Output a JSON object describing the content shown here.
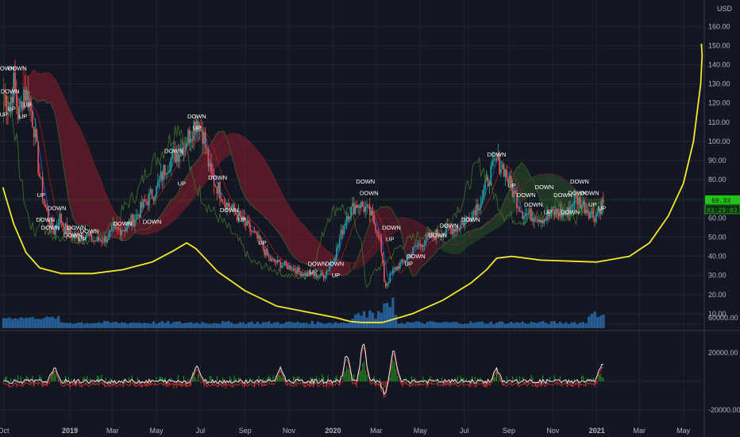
{
  "chart_data": {
    "type": "line",
    "title": "",
    "currency_label": "USD",
    "price_axis": {
      "ticks": [
        "160.00",
        "150.00",
        "140.00",
        "130.00",
        "120.00",
        "110.00",
        "100.00",
        "90.00",
        "80.00",
        "70.00",
        "60.00",
        "50.00",
        "40.00",
        "30.00",
        "20.00",
        "10.00"
      ],
      "ylim": [
        5,
        168
      ]
    },
    "time_axis": {
      "ticks": [
        "Oct",
        "2019",
        "Mar",
        "May",
        "Jul",
        "Sep",
        "Nov",
        "2020",
        "Mar",
        "May",
        "Jul",
        "Sep",
        "Nov",
        "2021",
        "Mar",
        "May"
      ],
      "xlim": [
        "2018-09-26",
        "2021-05-30"
      ]
    },
    "oscillator_axis": {
      "ticks": [
        "60000.00",
        "20000.00",
        "-20000.00"
      ]
    },
    "last_price_tag": "69.33",
    "countdown_tag": "03:29:03",
    "colors": {
      "background": "#131722",
      "up": "#26a69a",
      "down": "#ef5350",
      "cloud_bear": "#8b1e2e",
      "cloud_bull": "#2e5d2e",
      "annotation": "#f5e82a",
      "volume": "#2a6aa8",
      "price_tag": "#22c41a",
      "osc_line": "#e6e6e6"
    },
    "price_series": [
      {
        "x": "2018-10-01",
        "y": 125
      },
      {
        "x": "2018-10-08",
        "y": 118
      },
      {
        "x": "2018-10-15",
        "y": 130
      },
      {
        "x": "2018-10-22",
        "y": 112
      },
      {
        "x": "2018-10-29",
        "y": 127
      },
      {
        "x": "2018-11-05",
        "y": 122
      },
      {
        "x": "2018-11-12",
        "y": 108
      },
      {
        "x": "2018-11-19",
        "y": 84
      },
      {
        "x": "2018-11-26",
        "y": 68
      },
      {
        "x": "2018-12-03",
        "y": 58
      },
      {
        "x": "2018-12-10",
        "y": 53
      },
      {
        "x": "2018-12-17",
        "y": 61
      },
      {
        "x": "2018-12-24",
        "y": 55
      },
      {
        "x": "2019-01-07",
        "y": 50
      },
      {
        "x": "2019-01-21",
        "y": 52
      },
      {
        "x": "2019-02-04",
        "y": 48
      },
      {
        "x": "2019-02-18",
        "y": 49
      },
      {
        "x": "2019-03-04",
        "y": 53
      },
      {
        "x": "2019-03-18",
        "y": 55
      },
      {
        "x": "2019-04-01",
        "y": 60
      },
      {
        "x": "2019-04-15",
        "y": 68
      },
      {
        "x": "2019-05-01",
        "y": 75
      },
      {
        "x": "2019-05-15",
        "y": 88
      },
      {
        "x": "2019-06-01",
        "y": 95
      },
      {
        "x": "2019-06-15",
        "y": 103
      },
      {
        "x": "2019-06-26",
        "y": 112
      },
      {
        "x": "2019-07-05",
        "y": 104
      },
      {
        "x": "2019-07-15",
        "y": 82
      },
      {
        "x": "2019-07-25",
        "y": 76
      },
      {
        "x": "2019-08-05",
        "y": 68
      },
      {
        "x": "2019-08-20",
        "y": 62
      },
      {
        "x": "2019-09-05",
        "y": 55
      },
      {
        "x": "2019-09-20",
        "y": 48
      },
      {
        "x": "2019-10-05",
        "y": 38
      },
      {
        "x": "2019-10-20",
        "y": 36
      },
      {
        "x": "2019-11-05",
        "y": 34
      },
      {
        "x": "2019-11-20",
        "y": 31
      },
      {
        "x": "2019-12-05",
        "y": 30
      },
      {
        "x": "2019-12-20",
        "y": 30
      },
      {
        "x": "2020-01-05",
        "y": 42
      },
      {
        "x": "2020-01-20",
        "y": 62
      },
      {
        "x": "2020-02-05",
        "y": 68
      },
      {
        "x": "2020-02-20",
        "y": 63
      },
      {
        "x": "2020-03-05",
        "y": 52
      },
      {
        "x": "2020-03-13",
        "y": 24
      },
      {
        "x": "2020-03-25",
        "y": 33
      },
      {
        "x": "2020-04-10",
        "y": 38
      },
      {
        "x": "2020-04-25",
        "y": 45
      },
      {
        "x": "2020-05-10",
        "y": 49
      },
      {
        "x": "2020-05-25",
        "y": 52
      },
      {
        "x": "2020-06-10",
        "y": 54
      },
      {
        "x": "2020-06-25",
        "y": 56
      },
      {
        "x": "2020-07-10",
        "y": 62
      },
      {
        "x": "2020-07-25",
        "y": 70
      },
      {
        "x": "2020-08-05",
        "y": 82
      },
      {
        "x": "2020-08-15",
        "y": 90
      },
      {
        "x": "2020-08-25",
        "y": 86
      },
      {
        "x": "2020-09-05",
        "y": 75
      },
      {
        "x": "2020-09-20",
        "y": 63
      },
      {
        "x": "2020-10-05",
        "y": 61
      },
      {
        "x": "2020-10-20",
        "y": 60
      },
      {
        "x": "2020-11-05",
        "y": 63
      },
      {
        "x": "2020-11-20",
        "y": 62
      },
      {
        "x": "2020-12-01",
        "y": 71
      },
      {
        "x": "2020-12-15",
        "y": 66
      },
      {
        "x": "2020-12-28",
        "y": 61
      },
      {
        "x": "2021-01-05",
        "y": 65
      },
      {
        "x": "2021-01-10",
        "y": 69
      }
    ],
    "annotation_curve": [
      {
        "x": "2018-09-30",
        "y": 76
      },
      {
        "x": "2018-10-15",
        "y": 57
      },
      {
        "x": "2018-11-01",
        "y": 42
      },
      {
        "x": "2018-11-20",
        "y": 34
      },
      {
        "x": "2018-12-20",
        "y": 31
      },
      {
        "x": "2019-02-01",
        "y": 31
      },
      {
        "x": "2019-03-15",
        "y": 33
      },
      {
        "x": "2019-04-25",
        "y": 37
      },
      {
        "x": "2019-05-25",
        "y": 43
      },
      {
        "x": "2019-06-12",
        "y": 47
      },
      {
        "x": "2019-06-25",
        "y": 44
      },
      {
        "x": "2019-07-25",
        "y": 32
      },
      {
        "x": "2019-09-01",
        "y": 22
      },
      {
        "x": "2019-10-15",
        "y": 14
      },
      {
        "x": "2019-11-25",
        "y": 11
      },
      {
        "x": "2020-01-05",
        "y": 8
      },
      {
        "x": "2020-01-25",
        "y": 6
      },
      {
        "x": "2020-02-10",
        "y": 5.5
      },
      {
        "x": "2020-03-10",
        "y": 5.5
      },
      {
        "x": "2020-04-20",
        "y": 10
      },
      {
        "x": "2020-06-01",
        "y": 17
      },
      {
        "x": "2020-07-10",
        "y": 26
      },
      {
        "x": "2020-08-01",
        "y": 33
      },
      {
        "x": "2020-08-15",
        "y": 39
      },
      {
        "x": "2020-09-05",
        "y": 40
      },
      {
        "x": "2020-10-15",
        "y": 38
      },
      {
        "x": "2021-01-01",
        "y": 37
      },
      {
        "x": "2021-02-15",
        "y": 40
      },
      {
        "x": "2021-03-15",
        "y": 47
      },
      {
        "x": "2021-04-10",
        "y": 61
      },
      {
        "x": "2021-05-01",
        "y": 78
      },
      {
        "x": "2021-05-15",
        "y": 100
      },
      {
        "x": "2021-05-25",
        "y": 130
      },
      {
        "x": "2021-05-27",
        "y": 145
      },
      {
        "x": "2021-05-26",
        "y": 151
      }
    ],
    "signal_labels": [
      {
        "text": "DOWN",
        "x": "2018-10-03",
        "y": 137
      },
      {
        "text": "DOWN",
        "x": "2018-10-20",
        "y": 137
      },
      {
        "text": "DOWN",
        "x": "2018-10-10",
        "y": 125
      },
      {
        "text": "UP",
        "x": "2018-10-01",
        "y": 113
      },
      {
        "text": "UP",
        "x": "2018-10-12",
        "y": 116
      },
      {
        "text": "UP",
        "x": "2018-10-28",
        "y": 112
      },
      {
        "text": "UP",
        "x": "2018-11-03",
        "y": 118
      },
      {
        "text": "UP",
        "x": "2018-11-22",
        "y": 71
      },
      {
        "text": "DOWN",
        "x": "2018-12-14",
        "y": 64
      },
      {
        "text": "DOWN",
        "x": "2018-11-28",
        "y": 58
      },
      {
        "text": "DOWN",
        "x": "2018-12-05",
        "y": 54
      },
      {
        "text": "DOWN",
        "x": "2019-01-10",
        "y": 54
      },
      {
        "text": "DOWN",
        "x": "2019-01-05",
        "y": 50
      },
      {
        "text": "DOWN",
        "x": "2019-01-28",
        "y": 52
      },
      {
        "text": "UP",
        "x": "2019-01-18",
        "y": 48
      },
      {
        "text": "DOWN",
        "x": "2019-03-15",
        "y": 56
      },
      {
        "text": "DOWN",
        "x": "2019-04-25",
        "y": 57
      },
      {
        "text": "DOWN",
        "x": "2019-05-25",
        "y": 94
      },
      {
        "text": "UP",
        "x": "2019-06-05",
        "y": 77
      },
      {
        "text": "DOWN",
        "x": "2019-06-26",
        "y": 112
      },
      {
        "text": "UP",
        "x": "2019-06-26",
        "y": 106
      },
      {
        "text": "DOWN",
        "x": "2019-07-25",
        "y": 80
      },
      {
        "text": "DOWN",
        "x": "2019-08-10",
        "y": 63
      },
      {
        "text": "UP",
        "x": "2019-08-28",
        "y": 58
      },
      {
        "text": "UP",
        "x": "2019-09-25",
        "y": 46
      },
      {
        "text": "DOWN",
        "x": "2019-12-10",
        "y": 35
      },
      {
        "text": "DOWN",
        "x": "2020-01-03",
        "y": 35
      },
      {
        "text": "UP",
        "x": "2019-12-05",
        "y": 31
      },
      {
        "text": "UP",
        "x": "2020-01-05",
        "y": 29
      },
      {
        "text": "DOWN",
        "x": "2020-02-15",
        "y": 78
      },
      {
        "text": "DOWN",
        "x": "2020-02-20",
        "y": 72
      },
      {
        "text": "DOWN",
        "x": "2020-03-22",
        "y": 54
      },
      {
        "text": "UP",
        "x": "2020-03-20",
        "y": 48
      },
      {
        "text": "DOWN",
        "x": "2020-04-25",
        "y": 39
      },
      {
        "text": "UP",
        "x": "2020-04-15",
        "y": 35
      },
      {
        "text": "DOWN",
        "x": "2020-05-25",
        "y": 50
      },
      {
        "text": "DOWN",
        "x": "2020-06-10",
        "y": 55
      },
      {
        "text": "DOWN",
        "x": "2020-07-10",
        "y": 58
      },
      {
        "text": "DOWN",
        "x": "2020-08-15",
        "y": 92
      },
      {
        "text": "UP",
        "x": "2020-09-05",
        "y": 76
      },
      {
        "text": "DOWN",
        "x": "2020-09-25",
        "y": 71
      },
      {
        "text": "DOWN",
        "x": "2020-10-20",
        "y": 75
      },
      {
        "text": "DOWN",
        "x": "2020-11-15",
        "y": 71
      },
      {
        "text": "DOWN",
        "x": "2020-12-05",
        "y": 72
      },
      {
        "text": "DOWN",
        "x": "2020-12-22",
        "y": 72
      },
      {
        "text": "UP",
        "x": "2020-12-26",
        "y": 66
      },
      {
        "text": "UP",
        "x": "2021-01-08",
        "y": 64
      },
      {
        "text": "DOWN",
        "x": "2020-10-05",
        "y": 66
      },
      {
        "text": "DOWN",
        "x": "2020-11-25",
        "y": 62
      },
      {
        "text": "UP",
        "x": "2020-10-25",
        "y": 62
      },
      {
        "text": "DOWN",
        "x": "2020-12-08",
        "y": 78
      }
    ],
    "grid": true
  }
}
